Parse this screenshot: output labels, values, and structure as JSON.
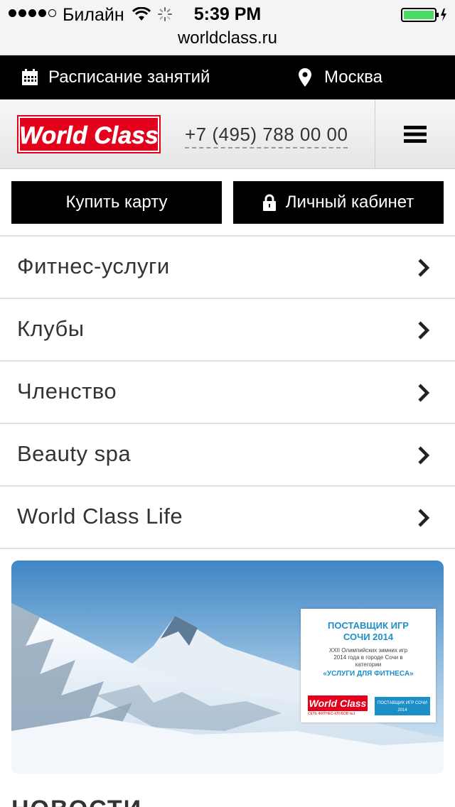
{
  "status_bar": {
    "carrier": "Билайн",
    "time": "5:39 PM",
    "url": "worldclass.ru"
  },
  "top_bar": {
    "schedule_label": "Расписание занятий",
    "city_label": "Москва"
  },
  "header": {
    "logo_text": "World Class",
    "phone": "+7 (495) 788 00 00"
  },
  "buttons": {
    "buy_card": "Купить карту",
    "personal_cabinet": "Личный кабинет"
  },
  "nav": [
    {
      "label": "Фитнес-услуги"
    },
    {
      "label": "Клубы"
    },
    {
      "label": "Членство"
    },
    {
      "label": "Beauty spa"
    },
    {
      "label": "World Class Life"
    }
  ],
  "banner": {
    "title": "ПОСТАВЩИК ИГР СОЧИ 2014",
    "text": "XXII Олимпийских зимних игр 2014 года в городе Сочи в категории",
    "accent": "«УСЛУГИ ДЛЯ ФИТНЕСА»",
    "logo_text": "World Class",
    "logo_sub": "СЕТЬ ФИТНЕС-КЛУБОВ №1",
    "badge": "ПОСТАВЩИК ИГР СОЧИ 2014"
  },
  "section": {
    "news_heading": "НОВОСТИ"
  },
  "colors": {
    "brand_red": "#e3001b",
    "accent_blue": "#1d8fc8",
    "battery_green": "#4cd964"
  }
}
